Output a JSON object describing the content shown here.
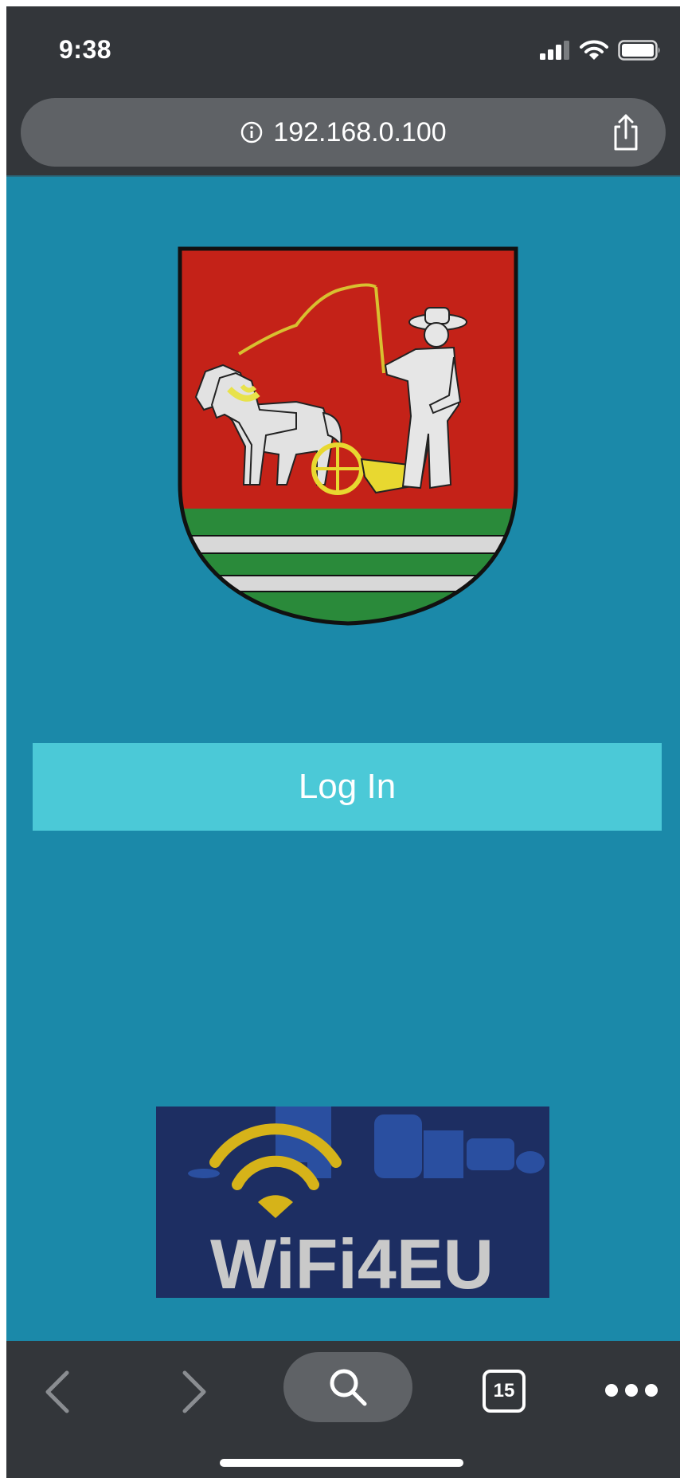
{
  "status_bar": {
    "time": "9:38",
    "icons": [
      "signal-icon",
      "wifi-icon",
      "battery-icon"
    ]
  },
  "address_bar": {
    "url": "192.168.0.100",
    "icons": [
      "info-icon",
      "share-icon"
    ]
  },
  "page": {
    "background_color": "#1b89a9",
    "crest": {
      "description_icon": "coat-of-arms-icon"
    },
    "login_button": {
      "label": "Log In",
      "color": "#4bc9d7"
    },
    "banner": {
      "text": "WiFi4EU",
      "icon": "wifi4eu-logo"
    }
  },
  "toolbar": {
    "tab_count": "15",
    "icons": [
      "back-icon",
      "forward-icon",
      "search-icon",
      "tabs-icon",
      "more-icon"
    ]
  }
}
